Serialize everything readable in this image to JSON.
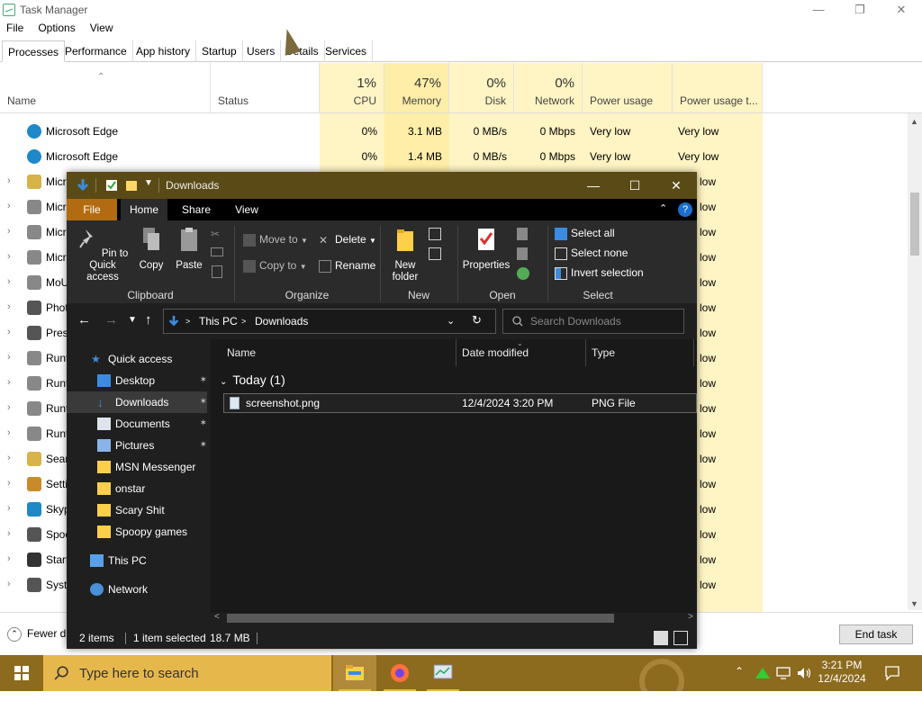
{
  "task_manager": {
    "title": "Task Manager",
    "menu": [
      "File",
      "Options",
      "View"
    ],
    "tabs": [
      "Processes",
      "Performance",
      "App history",
      "Startup",
      "Users",
      "Details",
      "Services"
    ],
    "active_tab": "Processes",
    "columns": {
      "name": "Name",
      "status": "Status",
      "cpu_pct": "1%",
      "cpu": "CPU",
      "memory_pct": "47%",
      "memory": "Memory",
      "disk_pct": "0%",
      "disk": "Disk",
      "network_pct": "0%",
      "network": "Network",
      "power": "Power usage",
      "power_trend": "Power usage t..."
    },
    "rows": [
      {
        "name": "Microsoft Edge",
        "cpu": "0%",
        "memory": "3.1 MB",
        "disk": "0 MB/s",
        "network": "0 Mbps",
        "power": "Very low",
        "power_trend": "Very low"
      },
      {
        "name": "Microsoft Edge",
        "cpu": "0%",
        "memory": "1.4 MB",
        "disk": "0 MB/s",
        "network": "0 Mbps",
        "power": "Very low",
        "power_trend": "Very low"
      },
      {
        "name": "Micr",
        "power_trend": "low"
      },
      {
        "name": "Micr",
        "power_trend": "low"
      },
      {
        "name": "Micr",
        "power_trend": "low"
      },
      {
        "name": "Micr",
        "power_trend": "low"
      },
      {
        "name": "MoU",
        "power_trend": "low"
      },
      {
        "name": "Phot",
        "power_trend": "low"
      },
      {
        "name": "Pres",
        "power_trend": "low"
      },
      {
        "name": "Runt",
        "power_trend": "low"
      },
      {
        "name": "Runt",
        "power_trend": "low"
      },
      {
        "name": "Runt",
        "power_trend": "low"
      },
      {
        "name": "Runt",
        "power_trend": "low"
      },
      {
        "name": "Sear",
        "power_trend": "low"
      },
      {
        "name": "Setti",
        "power_trend": "low"
      },
      {
        "name": "Skyp",
        "power_trend": "low"
      },
      {
        "name": "Spoo",
        "power_trend": "low"
      },
      {
        "name": "Start",
        "power_trend": "low"
      },
      {
        "name": "Syste",
        "power_trend": "low"
      }
    ],
    "fewer_details": "Fewer d",
    "end_task": "End task"
  },
  "explorer": {
    "title": "Downloads",
    "tabs": [
      "File",
      "Home",
      "Share",
      "View"
    ],
    "ribbon": {
      "clipboard": {
        "label": "Clipboard",
        "pin": "Pin to Quick access",
        "copy": "Copy",
        "paste": "Paste"
      },
      "organize": {
        "label": "Organize",
        "move_to": "Move to",
        "copy_to": "Copy to",
        "delete": "Delete",
        "rename": "Rename"
      },
      "new": {
        "label": "New",
        "new_folder": "New folder"
      },
      "open": {
        "label": "Open",
        "properties": "Properties"
      },
      "select": {
        "label": "Select",
        "select_all": "Select all",
        "select_none": "Select none",
        "invert": "Invert selection"
      }
    },
    "address": {
      "crumbs": [
        "This PC",
        "Downloads"
      ]
    },
    "search_placeholder": "Search Downloads",
    "nav": [
      {
        "label": "Quick access"
      },
      {
        "label": "Desktop",
        "pinned": true
      },
      {
        "label": "Downloads",
        "pinned": true,
        "selected": true
      },
      {
        "label": "Documents",
        "pinned": true
      },
      {
        "label": "Pictures",
        "pinned": true
      },
      {
        "label": "MSN Messenger"
      },
      {
        "label": "onstar"
      },
      {
        "label": "Scary Shit"
      },
      {
        "label": "Spoopy games"
      },
      {
        "label": "This PC"
      },
      {
        "label": "Network"
      }
    ],
    "content_columns": [
      "Name",
      "Date modified",
      "Type"
    ],
    "group": "Today (1)",
    "files": [
      {
        "name": "screenshot.png",
        "date": "12/4/2024 3:20 PM",
        "type": "PNG File"
      }
    ],
    "status": {
      "items": "2 items",
      "selected": "1 item selected",
      "size": "18.7 MB"
    }
  },
  "taskbar": {
    "search_label": "Type here to search",
    "time": "3:21 PM",
    "date": "12/4/2024"
  },
  "colors": {
    "accent": "#8c6a1e",
    "search_bg": "#e6b84c",
    "explorer_title": "#5a4a16",
    "file_tab": "#b36b12",
    "highlight": "#fff4c4"
  }
}
